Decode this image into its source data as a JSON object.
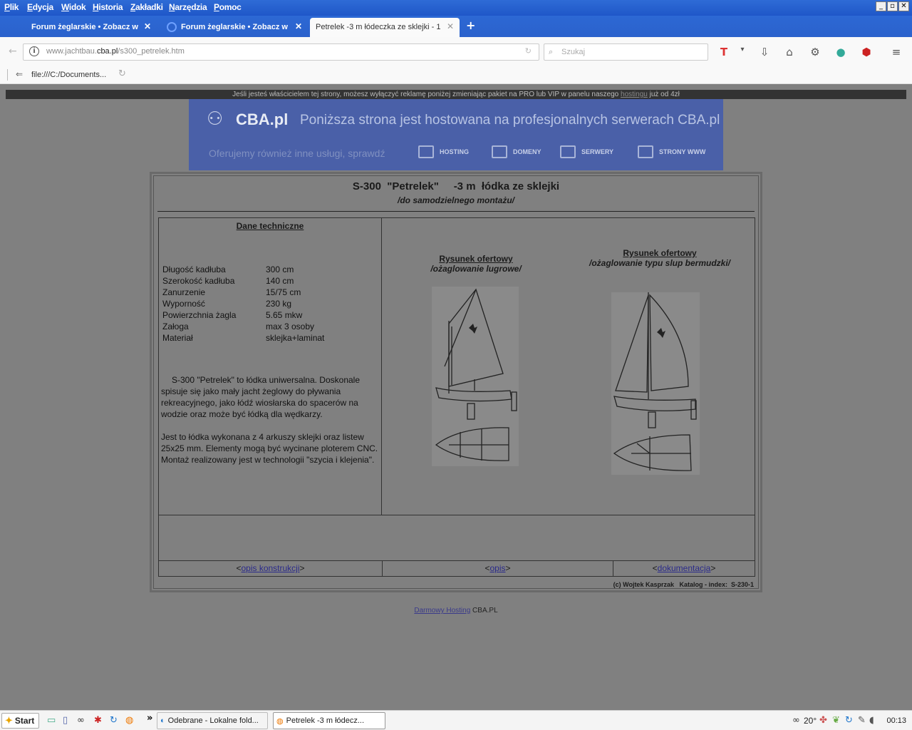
{
  "menu": {
    "items": [
      "Plik",
      "Edycja",
      "Widok",
      "Historia",
      "Zakładki",
      "Narzędzia",
      "Pomoc"
    ]
  },
  "window_controls": {
    "minimize": "_",
    "restore": "▫",
    "close": "✕"
  },
  "tabs": [
    {
      "title": "Forum żeglarskie • Zobacz wą...",
      "close": "✕"
    },
    {
      "title": "Forum żeglarskie • Zobacz wą...",
      "close": "✕"
    },
    {
      "title": "Petrelek -3 m łódeczka ze sklejki - 1",
      "close": "✕"
    }
  ],
  "new_tab": "+",
  "navbar": {
    "url_prefix": "www.jachtbau.",
    "url_domain": "cba.pl",
    "url_suffix": "/s300_petrelek.htm",
    "search_placeholder": "Szukaj"
  },
  "bookmarks": {
    "label": "file:///C:/Documents..."
  },
  "ad_notice": {
    "text_before": "Jeśli jesteś właścicielem tej strony, możesz wyłączyć reklamę poniżej zmieniając pakiet na PRO lub VIP w panelu naszego ",
    "link": "hostingu",
    "text_after": " już od 4zł"
  },
  "cba_banner": {
    "logo": "CBA.pl",
    "headline": "Poniższa strona jest hostowana na profesjonalnych serwerach CBA.pl",
    "offer": "Oferujemy również inne usługi, sprawdź",
    "nav": [
      "HOSTING",
      "DOMENY",
      "SERWERY",
      "STRONY WWW"
    ]
  },
  "page": {
    "title": "S-300  \"Petrelek\"     -3 m  łódka ze sklejki",
    "subtitle": "/do samodzielnego montażu/",
    "tech_heading": "Dane techniczne",
    "specs": [
      {
        "label": "Długość kadłuba",
        "value": "300 cm"
      },
      {
        "label": "Szerokość kadłuba",
        "value": "140 cm"
      },
      {
        "label": "Zanurzenie",
        "value": "15/75 cm"
      },
      {
        "label": "Wyporność",
        "value": "230 kg"
      },
      {
        "label": "Powierzchnia  żagla",
        "value": "5.65 mkw"
      },
      {
        "label": "Załoga",
        "value": "max 3 osoby"
      },
      {
        "label": "Materiał",
        "value": "sklejka+laminat"
      }
    ],
    "description_1": "S-300 \"Petrelek\" to łódka uniwersalna. Doskonale spisuje się jako mały jacht żeglowy do pływania rekreacyjnego, jako łódź wiosłarska do spacerów na wodzie oraz może być łódką dla wędkarzy.",
    "description_2": "Jest to łódka wykonana z 4 arkuszy sklejki oraz listew 25x25 mm. Elementy mogą być wycinane ploterem CNC. Montaż realizowany jest w technologii \"szycia i klejenia\".",
    "drawings": [
      {
        "heading": "Rysunek ofertowy",
        "subheading": "/ożaglowanie lugrowe/"
      },
      {
        "heading": "Rysunek ofertowy",
        "subheading": "/ożaglowanie typu slup bermudzki/"
      }
    ],
    "nav_links": [
      {
        "lt": "<",
        "label": "opis konstrukcji",
        "gt": ">"
      },
      {
        "lt": "<",
        "label": "opis",
        "gt": ">"
      },
      {
        "lt": "<",
        "label": "dokumentacja",
        "gt": ">"
      }
    ],
    "copyright": "(c) Wojtek Kasprzak   Katalog - index:  S-230-1"
  },
  "footer": {
    "link": "Darmowy Hosting",
    "suffix": " CBA.PL"
  },
  "taskbar": {
    "start": "Start",
    "tasks": [
      {
        "label": "Odebrane - Lokalne fold..."
      },
      {
        "label": "Petrelek -3 m łódecz..."
      }
    ],
    "chevron": "»",
    "temperature": "20°",
    "clock": "00:13"
  },
  "colors": {
    "menubar": "#1f57c8",
    "page_background": "#808080",
    "banner": "#4a60a8"
  }
}
